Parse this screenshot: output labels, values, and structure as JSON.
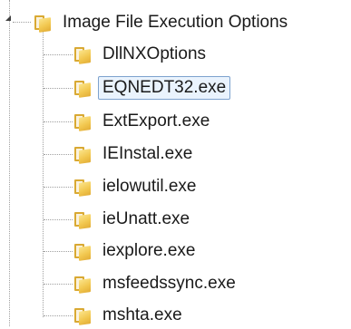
{
  "tree": {
    "root": {
      "label": "Image File Execution Options",
      "expanded": true,
      "icon": "folder-icon",
      "expander_icon": "expanded-triangle-icon"
    },
    "children": [
      {
        "label": "DllNXOptions",
        "icon": "folder-icon",
        "selected": false
      },
      {
        "label": "EQNEDT32.exe",
        "icon": "folder-icon",
        "selected": true
      },
      {
        "label": "ExtExport.exe",
        "icon": "folder-icon",
        "selected": false
      },
      {
        "label": "IEInstal.exe",
        "icon": "folder-icon",
        "selected": false
      },
      {
        "label": "ielowutil.exe",
        "icon": "folder-icon",
        "selected": false
      },
      {
        "label": "ieUnatt.exe",
        "icon": "folder-icon",
        "selected": false
      },
      {
        "label": "iexplore.exe",
        "icon": "folder-icon",
        "selected": false
      },
      {
        "label": "msfeedssync.exe",
        "icon": "folder-icon",
        "selected": false
      },
      {
        "label": "mshta.exe",
        "icon": "folder-icon",
        "selected": false
      }
    ]
  },
  "colors": {
    "folder": "#f2c850",
    "selection_border": "#7da2ce",
    "selection_fill": "#eaf3fd",
    "guide_line": "#a0a0a0"
  }
}
